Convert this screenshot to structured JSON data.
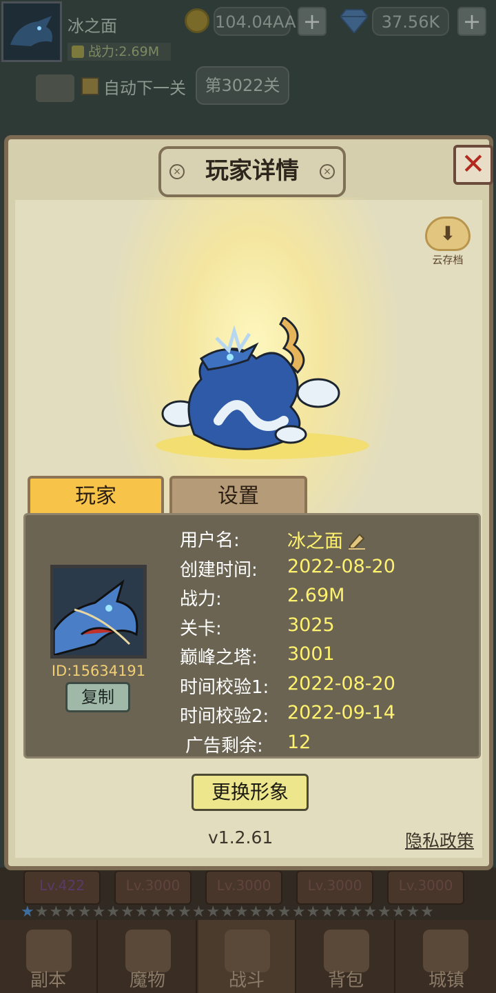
{
  "hud": {
    "player_name": "冰之面",
    "power": "战力:2.69M",
    "gold": "104.04AA",
    "gems": "37.56K",
    "plus": "+",
    "auto_next": "自动下一关",
    "stage": "第3022关"
  },
  "modal": {
    "title": "玩家详情",
    "close": "✕",
    "cloud_save": "云存档",
    "tabs": [
      {
        "label": "玩家",
        "active": true
      },
      {
        "label": "设置",
        "active": false
      }
    ],
    "player_id": "ID:15634191",
    "copy_label": "复制",
    "info_rows": [
      {
        "label": "用户名:",
        "value": "冰之面"
      },
      {
        "label": "创建时间:",
        "value": "2022-08-20"
      },
      {
        "label": "战力:",
        "value": "2.69M"
      },
      {
        "label": "关卡:",
        "value": "3025"
      },
      {
        "label": "巅峰之塔:",
        "value": "3001"
      },
      {
        "label": "时间校验1:",
        "value": "2022-08-20"
      },
      {
        "label": "时间校验2:",
        "value": "2022-09-14"
      },
      {
        "label": "广告剩余:",
        "value": "12"
      }
    ],
    "change_avatar": "更换形象",
    "version": "v1.2.61",
    "privacy": "隐私政策"
  },
  "slots": [
    "Lv.422",
    "Lv.3000",
    "Lv.3000",
    "Lv.3000",
    "Lv.3000"
  ],
  "nav": [
    {
      "label": "副本",
      "active": false
    },
    {
      "label": "魔物",
      "active": false
    },
    {
      "label": "战斗",
      "active": true
    },
    {
      "label": "背包",
      "active": false
    },
    {
      "label": "城镇",
      "active": false
    }
  ],
  "colors": {
    "accent_gold": "#f7c349",
    "value_yellow": "#fff26e",
    "panel": "#6b6453",
    "close_red": "#b22a1e"
  }
}
